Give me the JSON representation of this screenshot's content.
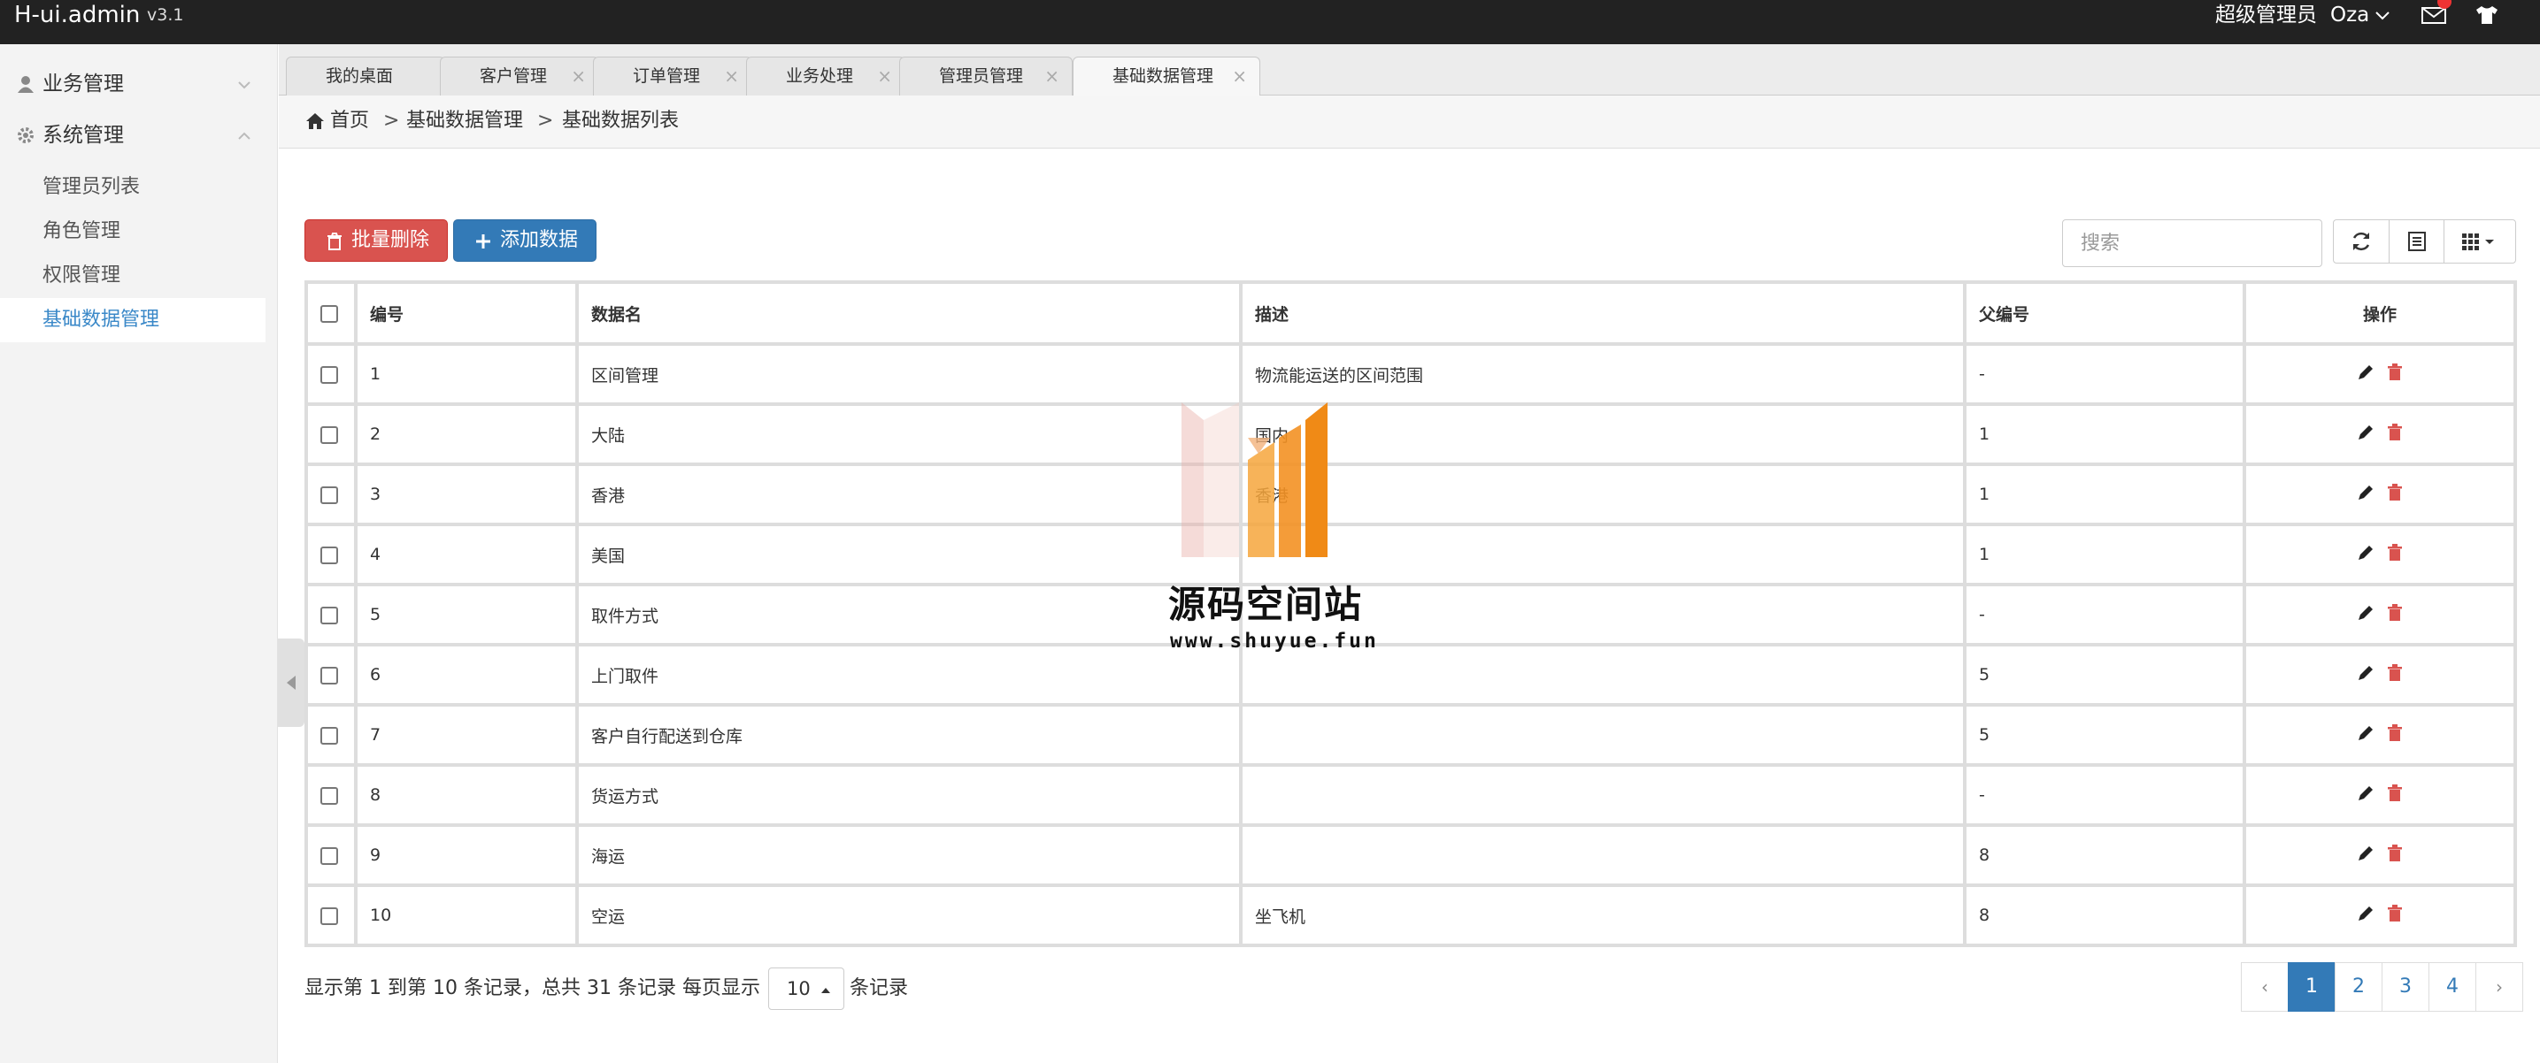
{
  "topbar": {
    "logo": "H-ui.admin",
    "version": "v3.1",
    "user_role": "超级管理员",
    "user_name": "Oza"
  },
  "sidebar": {
    "groups": [
      {
        "label": "业务管理",
        "icon": "user-icon",
        "expanded": false
      },
      {
        "label": "系统管理",
        "icon": "gear-icon",
        "expanded": true
      }
    ],
    "items": [
      {
        "label": "管理员列表"
      },
      {
        "label": "角色管理"
      },
      {
        "label": "权限管理"
      },
      {
        "label": "基础数据管理"
      }
    ],
    "active_item": "基础数据管理"
  },
  "tabs": [
    {
      "label": "我的桌面"
    },
    {
      "label": "客户管理"
    },
    {
      "label": "订单管理"
    },
    {
      "label": "业务处理"
    },
    {
      "label": "管理员管理"
    },
    {
      "label": "基础数据管理"
    }
  ],
  "active_tab": "基础数据管理",
  "breadcrumb": {
    "home": "首页",
    "separator": ">",
    "level1": "基础数据管理",
    "level2": "基础数据列表"
  },
  "toolbar": {
    "batch_delete": "批量删除",
    "add_data": "添加数据",
    "search_placeholder": "搜索"
  },
  "table": {
    "headers": {
      "id": "编号",
      "name": "数据名",
      "desc": "描述",
      "parent": "父编号",
      "ops": "操作"
    },
    "rows": [
      {
        "id": "1",
        "name": "区间管理",
        "desc": "物流能运送的区间范围",
        "parent": "-"
      },
      {
        "id": "2",
        "name": "大陆",
        "desc": "国内",
        "parent": "1"
      },
      {
        "id": "3",
        "name": "香港",
        "desc": "香港",
        "parent": "1"
      },
      {
        "id": "4",
        "name": "美国",
        "desc": "",
        "parent": "1"
      },
      {
        "id": "5",
        "name": "取件方式",
        "desc": "",
        "parent": "-"
      },
      {
        "id": "6",
        "name": "上门取件",
        "desc": "",
        "parent": "5"
      },
      {
        "id": "7",
        "name": "客户自行配送到仓库",
        "desc": "",
        "parent": "5"
      },
      {
        "id": "8",
        "name": "货运方式",
        "desc": "",
        "parent": "-"
      },
      {
        "id": "9",
        "name": "海运",
        "desc": "",
        "parent": "8"
      },
      {
        "id": "10",
        "name": "空运",
        "desc": "坐飞机",
        "parent": "8"
      }
    ]
  },
  "pagination": {
    "summary": "显示第 1 到第 10 条记录，总共 31 条记录",
    "per_page_prefix": "每页显示",
    "per_page_value": "10",
    "per_page_suffix": "条记录",
    "prev": "‹",
    "next": "›",
    "pages": [
      "1",
      "2",
      "3",
      "4"
    ],
    "current": "1"
  },
  "watermark": {
    "title": "源码空间站",
    "url": "www.shuyue.fun"
  },
  "colors": {
    "topbar": "#222222",
    "danger": "#d9534f",
    "primary": "#337ab7",
    "link_active": "#3a88c8",
    "delete_icon": "#d9534f",
    "watermark_orange": "#f08a16"
  }
}
